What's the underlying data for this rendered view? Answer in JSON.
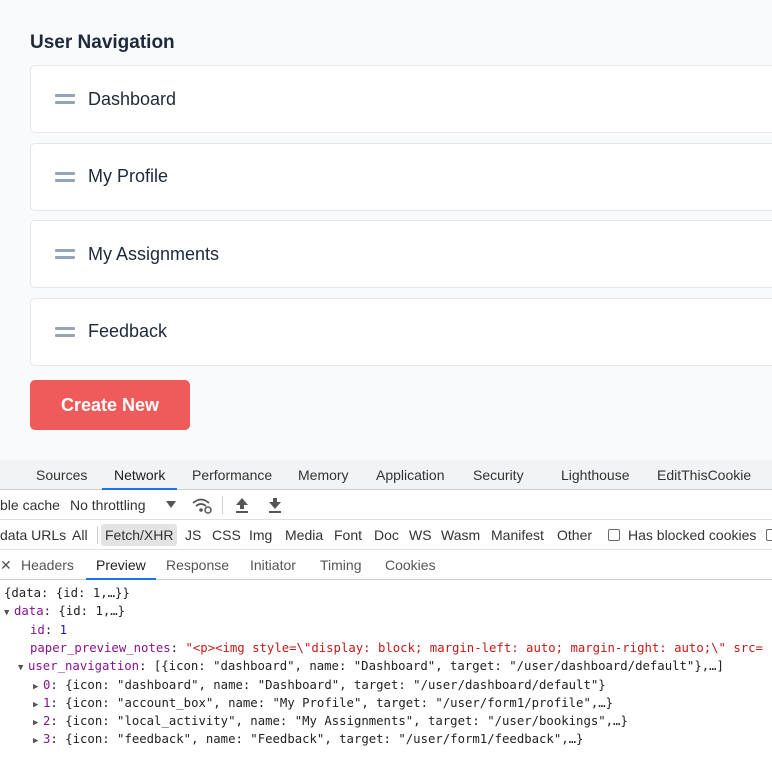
{
  "app": {
    "section_title": "User Navigation",
    "nav_items": [
      {
        "label": "Dashboard"
      },
      {
        "label": "My Profile"
      },
      {
        "label": "My Assignments"
      },
      {
        "label": "Feedback"
      }
    ],
    "create_button": "Create New",
    "accent_color": "#ef5a5a"
  },
  "devtools": {
    "main_tabs": [
      "Sources",
      "Network",
      "Performance",
      "Memory",
      "Application",
      "Security",
      "Lighthouse",
      "EditThisCookie"
    ],
    "active_main_tab": "Network",
    "cache_label": "ble cache",
    "throttling": "No throttling",
    "filters": [
      "data URLs",
      "All",
      "Fetch/XHR",
      "JS",
      "CSS",
      "Img",
      "Media",
      "Font",
      "Doc",
      "WS",
      "Wasm",
      "Manifest",
      "Other"
    ],
    "active_filter": "Fetch/XHR",
    "blocked_cookies_label": "Has blocked cookies",
    "sub_tabs": [
      "Headers",
      "Preview",
      "Response",
      "Initiator",
      "Timing",
      "Cookies"
    ],
    "active_sub_tab": "Preview",
    "preview": {
      "root": "{data: {id: 1,…}}",
      "data_key": "data",
      "data_summary": ": {id: 1,…}",
      "id_key": "id",
      "id_value": "1",
      "notes_key": "paper_preview_notes",
      "notes_value": "\"<p><img style=\\\"display: block; margin-left: auto; margin-right: auto;\\\" src=",
      "nav_key": "user_navigation",
      "nav_summary": ": [{icon: \"dashboard\", name: \"Dashboard\", target: \"/user/dashboard/default\"},…]",
      "items": [
        {
          "index": "0",
          "text": ": {icon: \"dashboard\", name: \"Dashboard\", target: \"/user/dashboard/default\"}"
        },
        {
          "index": "1",
          "text": ": {icon: \"account_box\", name: \"My Profile\", target: \"/user/form1/profile\",…}"
        },
        {
          "index": "2",
          "text": ": {icon: \"local_activity\", name: \"My Assignments\", target: \"/user/bookings\",…}"
        },
        {
          "index": "3",
          "text": ": {icon: \"feedback\", name: \"Feedback\", target: \"/user/form1/feedback\",…}"
        }
      ]
    }
  }
}
